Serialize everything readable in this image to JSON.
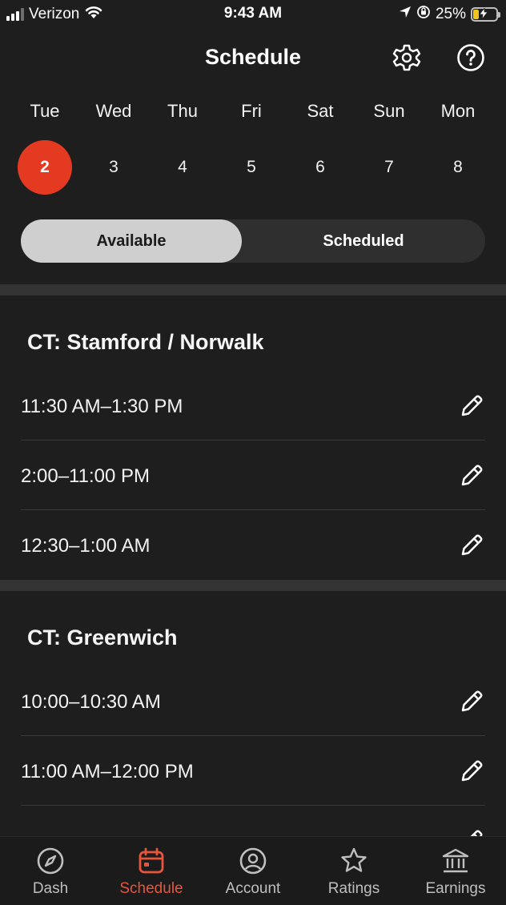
{
  "status_bar": {
    "carrier": "Verizon",
    "time": "9:43 AM",
    "battery": "25%",
    "battery_level": 0.25
  },
  "header": {
    "title": "Schedule",
    "settings_icon": "gear-icon",
    "help_icon": "help-icon"
  },
  "week": {
    "days": [
      "Tue",
      "Wed",
      "Thu",
      "Fri",
      "Sat",
      "Sun",
      "Mon"
    ],
    "dates": [
      "2",
      "3",
      "4",
      "5",
      "6",
      "7",
      "8"
    ],
    "selected_index": 0,
    "accent_color": "#e53a22"
  },
  "toggle": {
    "available_label": "Available",
    "scheduled_label": "Scheduled",
    "selected": "Available"
  },
  "regions": [
    {
      "name": "CT: Stamford / Norwalk",
      "slots": [
        "11:30 AM–1:30 PM",
        "2:00–11:00 PM",
        "12:30–1:00 AM"
      ]
    },
    {
      "name": "CT: Greenwich",
      "slots": [
        "10:00–10:30 AM",
        "11:00 AM–12:00 PM"
      ]
    }
  ],
  "nav": {
    "items": [
      {
        "label": "Dash",
        "icon": "compass-icon"
      },
      {
        "label": "Schedule",
        "icon": "calendar-icon"
      },
      {
        "label": "Account",
        "icon": "account-icon"
      },
      {
        "label": "Ratings",
        "icon": "star-icon"
      },
      {
        "label": "Earnings",
        "icon": "bank-icon"
      }
    ],
    "active_index": 1,
    "active_color": "#e8553a"
  }
}
